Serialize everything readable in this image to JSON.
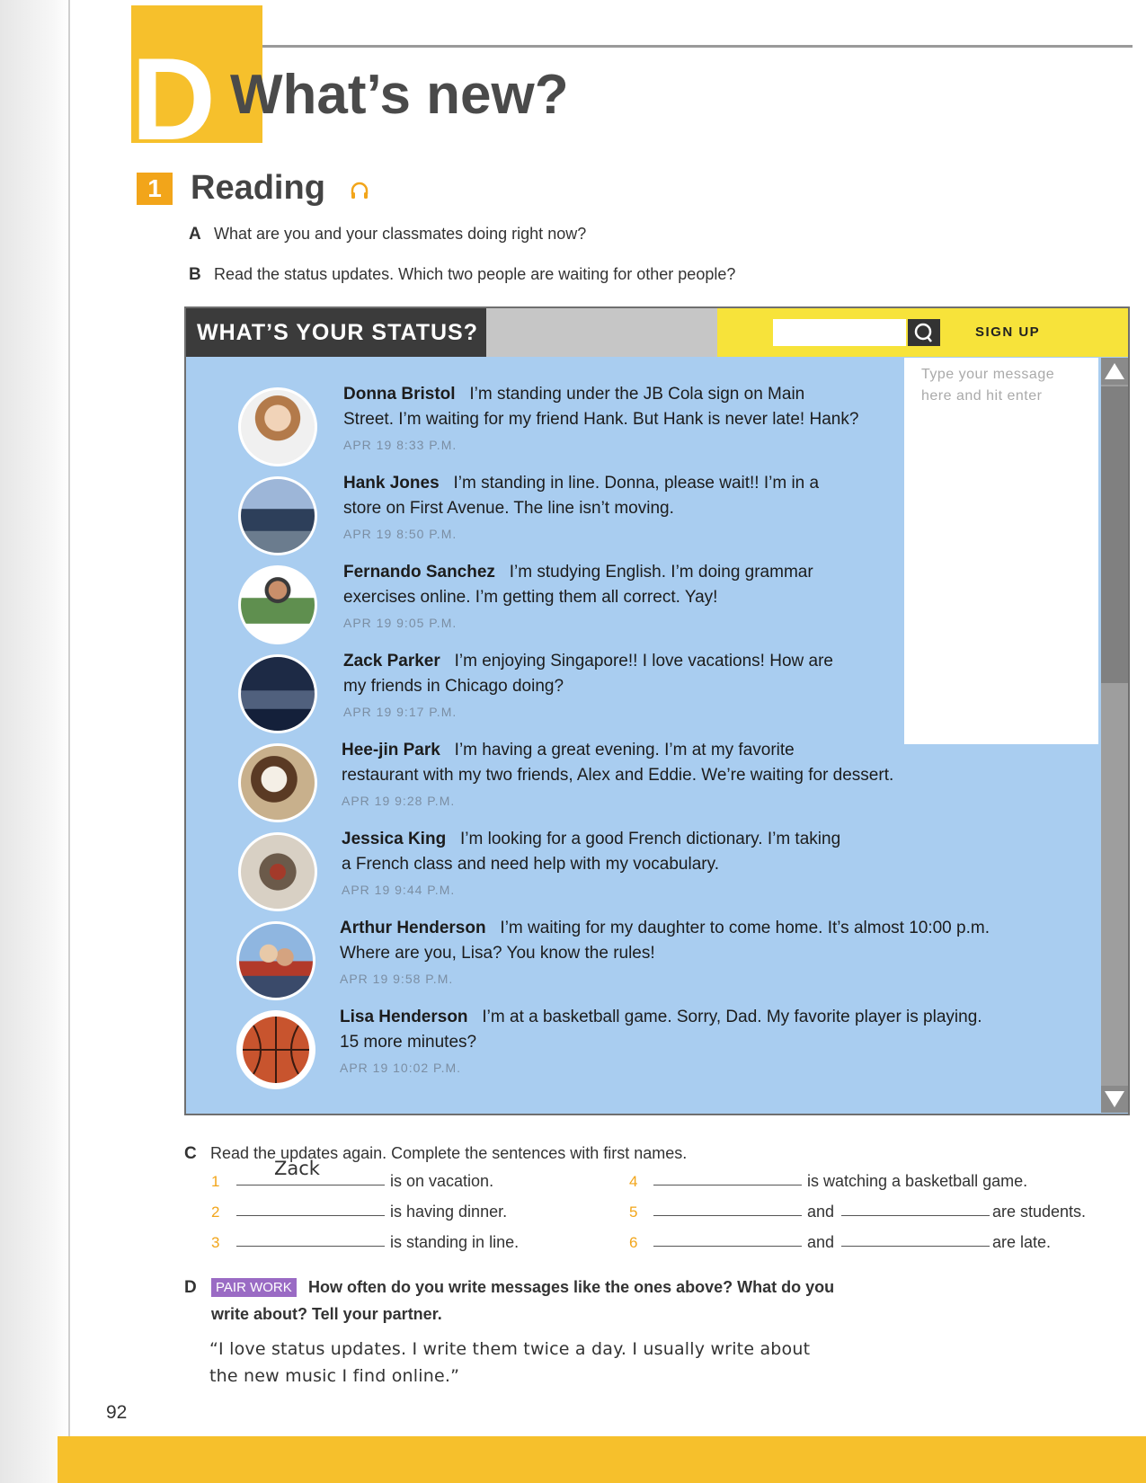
{
  "header": {
    "section_letter": "D",
    "title": "What’s new?"
  },
  "section": {
    "number": "1",
    "title": "Reading"
  },
  "questions": {
    "a": {
      "letter": "A",
      "text": "What are you and your classmates doing right now?"
    },
    "b": {
      "letter": "B",
      "text": "Read the status updates. Which two people are waiting for other people?"
    },
    "c": {
      "letter": "C",
      "text": "Read the updates again. Complete the sentences with first names."
    },
    "d": {
      "letter": "D",
      "badge": "PAIR WORK",
      "text_line1": "How often do you write messages like the ones above? What do you",
      "text_line2": "write about? Tell your partner."
    }
  },
  "status_app": {
    "header_title": "WHAT’S YOUR STATUS?",
    "signup_label": "SIGN UP",
    "message_placeholder_line1": "Type your message",
    "message_placeholder_line2": "here and hit enter",
    "posts": [
      {
        "name": "Donna Bristol",
        "line1": "I’m standing under the JB Cola sign on Main",
        "line2": "Street. I’m waiting for my friend Hank. But Hank is never late! Hank?",
        "time": "APR 19 8:33 P.M."
      },
      {
        "name": "Hank Jones",
        "line1": "I’m standing in line. Donna, please wait!! I’m in a",
        "line2": "store on First Avenue. The line isn’t moving.",
        "time": "APR 19 8:50 P.M."
      },
      {
        "name": "Fernando Sanchez",
        "line1": "I’m studying English. I’m doing grammar",
        "line2": "exercises online. I’m getting them all correct. Yay!",
        "time": "APR 19 9:05 P.M."
      },
      {
        "name": "Zack Parker",
        "line1": "I’m enjoying Singapore!! I love vacations! How are",
        "line2": "my friends in Chicago doing?",
        "time": "APR 19 9:17 P.M."
      },
      {
        "name": "Hee-jin Park",
        "line1": "I’m having a great evening. I’m at my favorite",
        "line2": "restaurant with my two friends, Alex and Eddie. We’re waiting for dessert.",
        "time": "APR 19 9:28 P.M."
      },
      {
        "name": "Jessica King",
        "line1": "I’m looking for a good French dictionary. I’m taking",
        "line2": "a French class and need help with my vocabulary.",
        "time": "APR 19 9:44 P.M."
      },
      {
        "name": "Arthur Henderson",
        "line1": "I’m waiting for my daughter to come home. It’s almost 10:00 p.m.",
        "line2": "Where are you, Lisa? You know the rules!",
        "time": "APR 19 9:58 P.M."
      },
      {
        "name": "Lisa Henderson",
        "line1": "I’m at a basketball game. Sorry, Dad. My favorite player is playing.",
        "line2": "15 more minutes?",
        "time": "APR 19 10:02 P.M."
      }
    ]
  },
  "exercise_c": {
    "items": [
      {
        "num": "1",
        "answer": "Zack",
        "text": "is on vacation."
      },
      {
        "num": "2",
        "answer": "",
        "text": "is having dinner."
      },
      {
        "num": "3",
        "answer": "",
        "text": "is standing in line."
      },
      {
        "num": "4",
        "answer": "",
        "text": "is watching a basketball game."
      },
      {
        "num": "5",
        "and": "and",
        "text": "are students."
      },
      {
        "num": "6",
        "and": "and",
        "text": "are late."
      }
    ]
  },
  "quote": {
    "line1": "“I love status updates. I write them twice a day. I usually write about",
    "line2": "the new music I find online.”"
  },
  "page_number": "92",
  "colors": {
    "accent_yellow": "#f6c02c",
    "orange": "#f2a51a",
    "status_blue": "#a9cdf0",
    "pair_work_purple": "#9a6bc4"
  }
}
